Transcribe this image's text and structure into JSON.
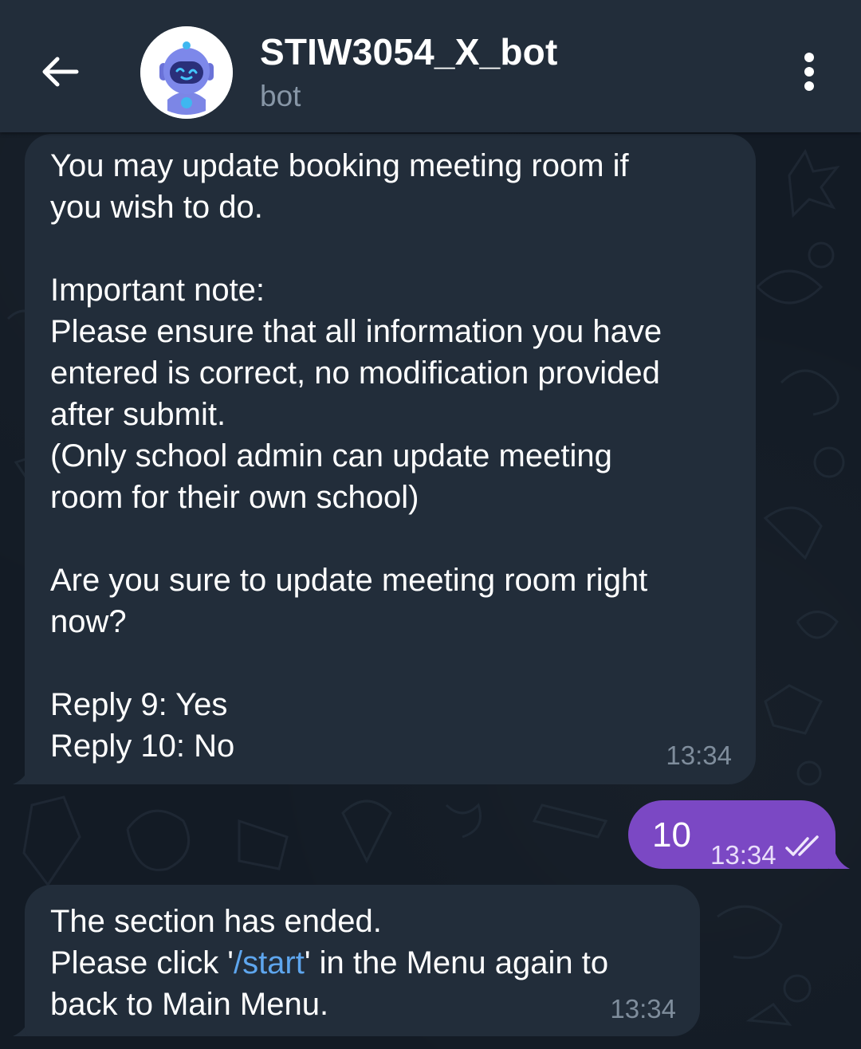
{
  "header": {
    "title": "STIW3054_X_bot",
    "subtitle": "bot"
  },
  "messages": [
    {
      "from": "bot",
      "text": "You may update booking meeting room if\nyou wish to do.\n\nImportant note:\nPlease ensure that all information you have\nentered is correct, no modification provided\nafter submit.\n(Only school admin can update meeting\nroom for their own school)\n\nAre you sure to update meeting room right\nnow?\n\nReply 9: Yes\nReply 10: No",
      "time": "13:34"
    },
    {
      "from": "user",
      "text": "10",
      "time": "13:34",
      "status": "read-double-check"
    },
    {
      "from": "bot",
      "line1": "The section has ended.",
      "line2_before": "Please click '",
      "line2_link": "/start",
      "line2_after": "' in the Menu again to",
      "line3": "back to Main Menu.",
      "time": "13:34"
    }
  ],
  "colors": {
    "header_bg": "#222d3a",
    "bubble_bg": "#222d3a",
    "outgoing_bubble": "#7b48c4",
    "link": "#5ea6ee",
    "chat_bg": "#131b25"
  },
  "icons": {
    "back": "arrow-left-icon",
    "menu": "more-vertical-icon",
    "status": "double-check-icon",
    "avatar": "robot-avatar"
  }
}
